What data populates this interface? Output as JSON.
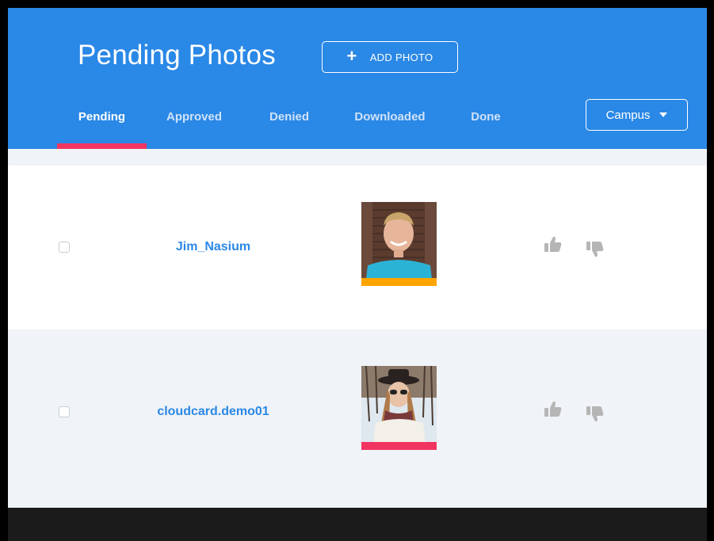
{
  "header": {
    "title": "Pending Photos",
    "add_button_label": "ADD PHOTO",
    "campus_label": "Campus"
  },
  "tabs": [
    {
      "label": "Pending",
      "active": true
    },
    {
      "label": "Approved",
      "active": false
    },
    {
      "label": "Denied",
      "active": false
    },
    {
      "label": "Downloaded",
      "active": false
    },
    {
      "label": "Done",
      "active": false
    }
  ],
  "rows": [
    {
      "username": "Jim_Nasium",
      "photo_status_color": "#ffa500"
    },
    {
      "username": "cloudcard.demo01",
      "photo_status_color": "#f23461"
    }
  ],
  "colors": {
    "header": "#2a88e6",
    "active_tab_underline": "#f23461",
    "link": "#2a88e6",
    "footer": "#1b1b1b",
    "vote_icon": "#b5b5b5"
  },
  "icons": {
    "add": "plus-icon",
    "dropdown": "caret-down-icon",
    "approve": "thumbs-up-icon",
    "deny": "thumbs-down-icon"
  }
}
